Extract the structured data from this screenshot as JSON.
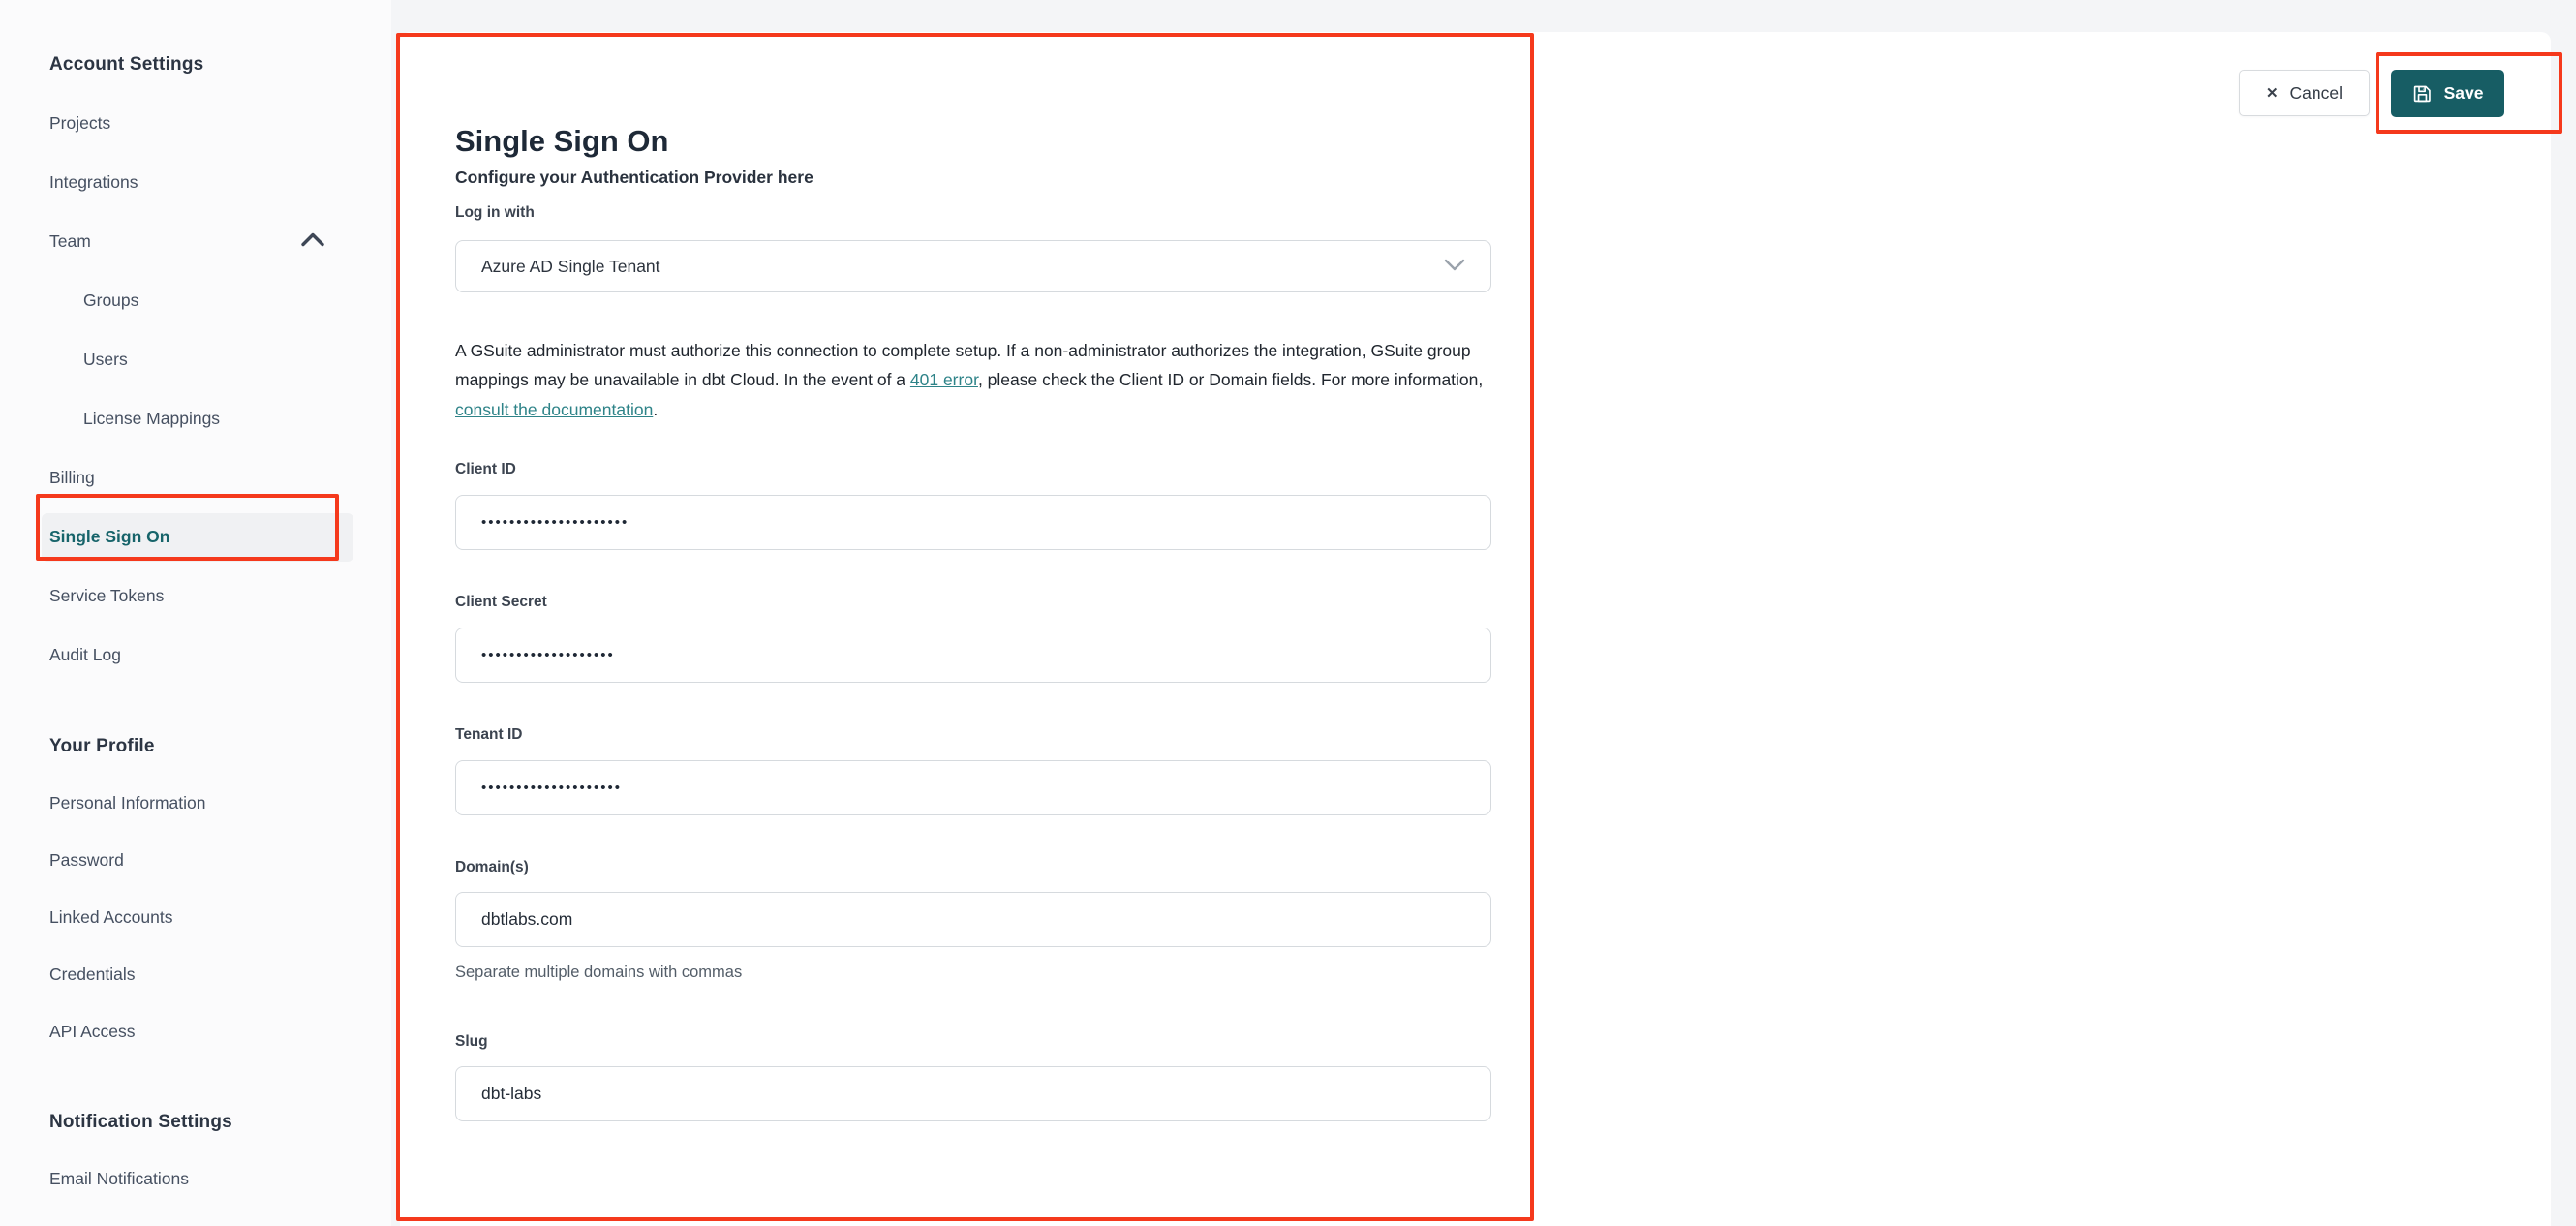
{
  "colors": {
    "page_bg": "#f4f5f7",
    "sidebar_bg": "#fbfbfc",
    "card_bg": "#ffffff",
    "active_teal": "#17646a",
    "link_teal": "#2e8388",
    "save_button_teal": "#175d64",
    "annotation_red": "#f5391c"
  },
  "sidebar": {
    "sections": [
      {
        "heading": "Account Settings",
        "items": [
          {
            "label": "Projects"
          },
          {
            "label": "Integrations"
          },
          {
            "label": "Team",
            "chevron": "chevron-up"
          },
          {
            "label": "Groups",
            "indent": true
          },
          {
            "label": "Users",
            "indent": true
          },
          {
            "label": "License Mappings",
            "indent": true
          },
          {
            "label": "Billing"
          },
          {
            "label": "Single Sign On",
            "active": true
          },
          {
            "label": "Service Tokens"
          },
          {
            "label": "Audit Log"
          }
        ]
      },
      {
        "heading": "Your Profile",
        "items": [
          {
            "label": "Personal Information"
          },
          {
            "label": "Password"
          },
          {
            "label": "Linked Accounts"
          },
          {
            "label": "Credentials"
          },
          {
            "label": "API Access"
          }
        ]
      },
      {
        "heading": "Notification Settings",
        "items": [
          {
            "label": "Email Notifications"
          }
        ]
      }
    ]
  },
  "main": {
    "title": "Single Sign On",
    "subtitle": "Configure your Authentication Provider here"
  },
  "actions": {
    "cancel_label": "Cancel",
    "cancel_icon": "✕",
    "save_label": "Save",
    "save_icon": "floppy-disk"
  },
  "form": {
    "login_with": {
      "label": "Log in with",
      "value": "Azure AD Single Tenant"
    },
    "notice": {
      "text_1": "A GSuite administrator must authorize this connection to complete setup. If a non-administrator authorizes the integration, GSuite group mappings may be unavailable in dbt Cloud. In the event of a ",
      "link_401": "401 error",
      "text_2": ", please check the Client ID or Domain fields. For more information, ",
      "link_docs": "consult the documentation",
      "text_3": "."
    },
    "fields": [
      {
        "label": "Client ID",
        "value": "•••••••••••••••••••••",
        "masked": true
      },
      {
        "label": "Client Secret",
        "value": "•••••••••••••••••••",
        "masked": true
      },
      {
        "label": "Tenant ID",
        "value": "••••••••••••••••••••",
        "masked": true
      },
      {
        "label": "Domain(s)",
        "value": "dbtlabs.com",
        "helper": "Separate multiple domains with commas"
      },
      {
        "label": "Slug",
        "value": "dbt-labs"
      }
    ]
  }
}
